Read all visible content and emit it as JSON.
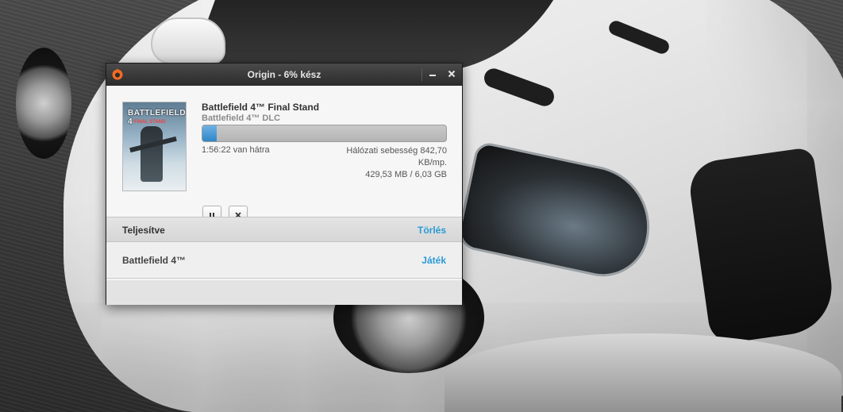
{
  "window": {
    "title": "Origin - 6% kész"
  },
  "download": {
    "game_title": "Battlefield 4™ Final Stand",
    "game_subtitle": "Battlefield 4™ DLC",
    "progress_fraction": 0.06,
    "time_left": "1:56:22 van hátra",
    "speed_line1": "Hálózati sebesség 842,70",
    "speed_line2": "KB/mp.",
    "size": "429,53 MB / 6,03 GB",
    "boxart_title": "BATTLEFIELD 4",
    "boxart_subtitle": "FINAL STAND"
  },
  "completed_section": {
    "label": "Teljesítve",
    "action": "Törlés"
  },
  "completed_items": [
    {
      "label": "Battlefield 4™",
      "action": "Játék"
    }
  ],
  "colors": {
    "accent": "#2a9ad6",
    "origin_orange": "#f26b21"
  },
  "icons": {
    "minimize": "minimize-icon",
    "close": "close-icon",
    "pause": "pause-icon",
    "cancel": "cancel-icon",
    "logo": "origin-logo-icon"
  }
}
